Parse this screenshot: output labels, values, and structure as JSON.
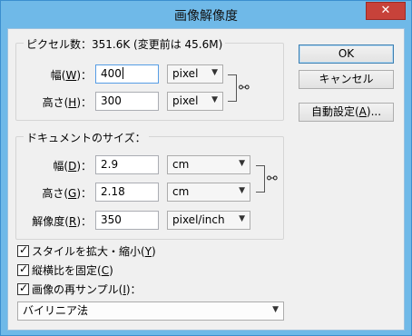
{
  "window": {
    "title": "画像解像度",
    "close_glyph": "✕"
  },
  "pixel_dimensions": {
    "heading": "ピクセル数：351.6K (変更前は 45.6M)",
    "width": {
      "label": "幅(",
      "accel": "W",
      "suffix": ")：",
      "value": "400",
      "unit": "pixel"
    },
    "height": {
      "label": "高さ(",
      "accel": "H",
      "suffix": ")：",
      "value": "300",
      "unit": "pixel"
    }
  },
  "document_size": {
    "heading": "ドキュメントのサイズ：",
    "width": {
      "label": "幅(",
      "accel": "D",
      "suffix": ")：",
      "value": "2.9",
      "unit": "cm"
    },
    "height": {
      "label": "高さ(",
      "accel": "G",
      "suffix": ")：",
      "value": "2.18",
      "unit": "cm"
    },
    "resolution": {
      "label": "解像度(",
      "accel": "R",
      "suffix": ")：",
      "value": "350",
      "unit": "pixel/inch"
    }
  },
  "buttons": {
    "ok": "OK",
    "cancel": "キャンセル",
    "auto_prefix": "自動設定(",
    "auto_accel": "A",
    "auto_suffix": ")..."
  },
  "options": {
    "scale_styles": {
      "label": "スタイルを拡大・縮小(",
      "accel": "Y",
      "suffix": ")",
      "checked": true
    },
    "constrain": {
      "label": "縦横比を固定(",
      "accel": "C",
      "suffix": ")",
      "checked": true
    },
    "resample": {
      "label": "画像の再サンプル(",
      "accel": "I",
      "suffix": ")：",
      "checked": true
    }
  },
  "resample_method": "バイリニア法",
  "icons": {
    "link": "link-icon",
    "dropdown": "chevron-down-icon",
    "check": "checkmark-icon"
  },
  "colors": {
    "title_bar": "#6fb9e8",
    "close_button": "#c7423a",
    "dialog_bg": "#f0f0f0"
  }
}
